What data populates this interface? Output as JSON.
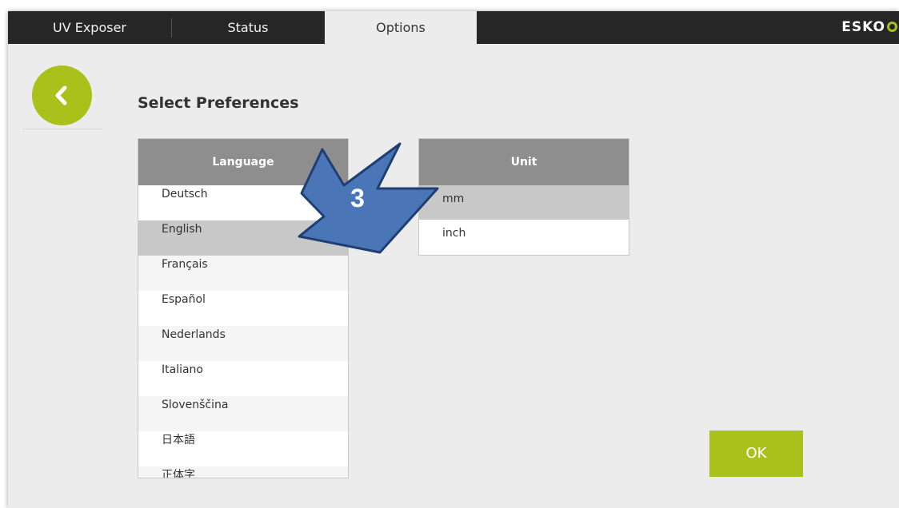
{
  "tabs": [
    {
      "label": "UV Exposer"
    },
    {
      "label": "Status"
    },
    {
      "label": "Options"
    }
  ],
  "active_tab": "Options",
  "logo": {
    "text": "ESKO"
  },
  "page": {
    "title": "Select Preferences"
  },
  "language_list": {
    "header": "Language",
    "items": [
      "Deutsch",
      "English",
      "Français",
      "Español",
      "Nederlands",
      "Italiano",
      "Slovenščina",
      "日本語",
      "正体字"
    ],
    "selected": "English"
  },
  "unit_list": {
    "header": "Unit",
    "items": [
      "mm",
      "inch"
    ],
    "selected": "mm"
  },
  "ok_button": {
    "label": "OK"
  },
  "annotation": {
    "number": "3",
    "color": "#4a76b8"
  },
  "colors": {
    "accent_green": "#a9c21b",
    "topbar": "#262626",
    "header_gray": "#8e8e8e",
    "selected_row": "#c8c8c8",
    "background": "#ececec"
  },
  "icons": {
    "back": "chevron-left-icon",
    "logo_mark": "esko-circle-icon"
  }
}
